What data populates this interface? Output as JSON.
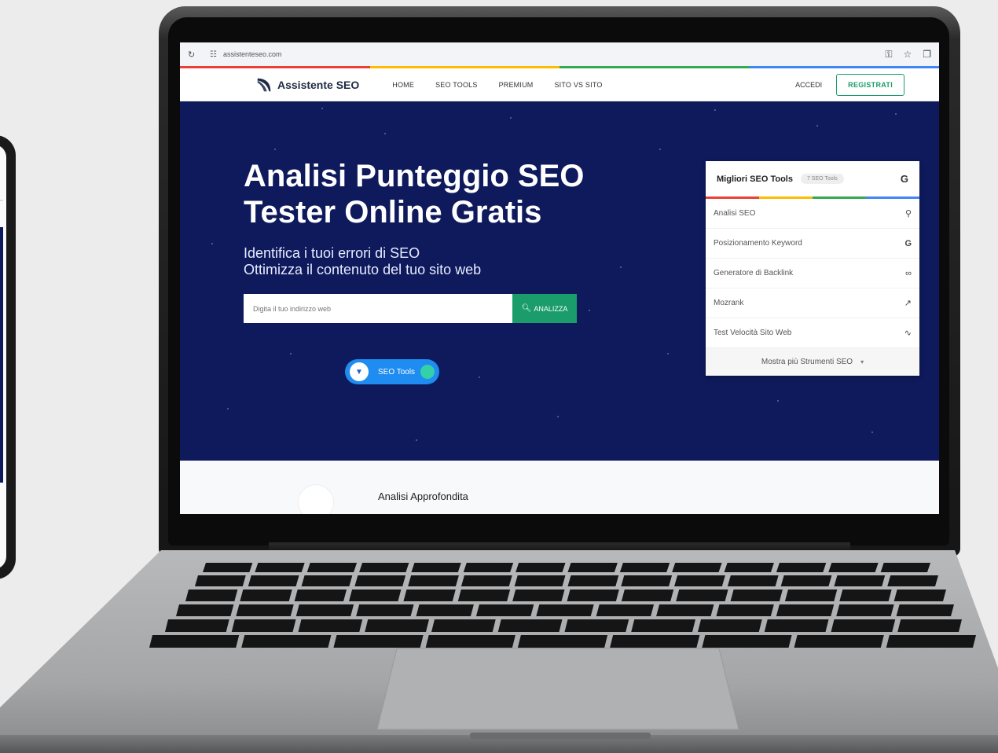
{
  "browser": {
    "url": "assistenteseo.com",
    "icons": [
      "reload-icon",
      "tune-icon",
      "key-icon",
      "star-icon",
      "extension-icon"
    ]
  },
  "colors": {
    "hero_bg": "#0e1a5c",
    "accent_green": "#1a9c6b",
    "google_red": "#e94235",
    "google_yellow": "#fbbc04",
    "google_green": "#34a853",
    "google_blue": "#4285f4"
  },
  "site": {
    "brand": "Assistente SEO",
    "nav": [
      "HOME",
      "SEO TOOLS",
      "PREMIUM",
      "SITO VS SITO"
    ],
    "login": "ACCEDI",
    "register": "REGISTRATI"
  },
  "hero": {
    "title_line1": "Analisi Punteggio SEO",
    "title_line2": "Tester Online Gratis",
    "subtitle_line1": "Identifica i tuoi errori di SEO",
    "subtitle_line2": "Ottimizza il contenuto del tuo sito web",
    "search_placeholder": "Digita il tuo indirizzo web",
    "search_button": "ANALIZZA",
    "toggle_label": "SEO Tools"
  },
  "tools_card": {
    "title": "Migliori SEO Tools",
    "badge": "7 SEO Tools",
    "items": [
      {
        "label": "Analisi SEO",
        "icon": "search-icon"
      },
      {
        "label": "Posizionamento Keyword",
        "icon": "google-icon"
      },
      {
        "label": "Generatore di Backlink",
        "icon": "link-icon"
      },
      {
        "label": "Mozrank",
        "icon": "chart-icon"
      },
      {
        "label": "Test Velocità Sito Web",
        "icon": "pulse-icon"
      }
    ],
    "more": "Mostra più Strumenti SEO"
  },
  "below": {
    "heading": "Analisi Approfondita"
  }
}
